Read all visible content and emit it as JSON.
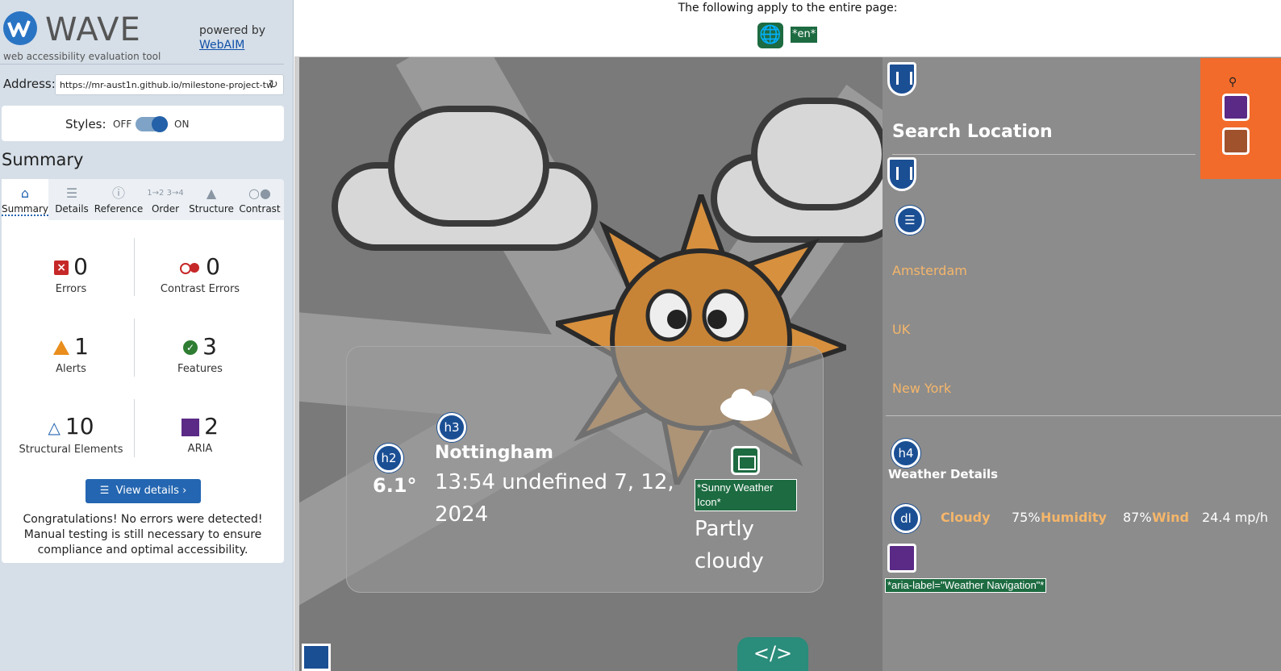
{
  "wave": {
    "logo_text": "WAVE",
    "tagline": "web accessibility evaluation tool",
    "powered_by": "powered by",
    "webaim_link": "WebAIM",
    "address_label": "Address:",
    "address_value": "https://mr-aust1n.github.io/milestone-project-tw",
    "styles_label": "Styles:",
    "styles_off": "OFF",
    "styles_on": "ON",
    "summary_title": "Summary",
    "tabs": [
      {
        "label": "Summary",
        "icon": "home-icon",
        "active": true
      },
      {
        "label": "Details",
        "icon": "list-icon",
        "active": false
      },
      {
        "label": "Reference",
        "icon": "info-icon",
        "active": false
      },
      {
        "label": "Order",
        "icon": "order-icon",
        "active": false
      },
      {
        "label": "Structure",
        "icon": "structure-icon",
        "active": false
      },
      {
        "label": "Contrast",
        "icon": "contrast-icon",
        "active": false
      }
    ],
    "stats": {
      "errors": {
        "value": "0",
        "label": "Errors"
      },
      "contrast_errors": {
        "value": "0",
        "label": "Contrast Errors"
      },
      "alerts": {
        "value": "1",
        "label": "Alerts"
      },
      "features": {
        "value": "3",
        "label": "Features"
      },
      "structural": {
        "value": "10",
        "label": "Structural Elements"
      },
      "aria": {
        "value": "2",
        "label": "ARIA"
      }
    },
    "view_details": "View details ›",
    "congrats": "Congratulations! No errors were detected! Manual testing is still necessary to ensure compliance and optimal accessibility."
  },
  "page_notice": {
    "text": "The following apply to the entire page:",
    "lang_tag": "*en*"
  },
  "weather_card": {
    "h2_badge": "h2",
    "h3_badge": "h3",
    "temperature": "6.1°",
    "city": "Nottingham",
    "datetime": "13:54 undefined 7, 12, 2024",
    "image_alt": "*Sunny Weather Icon*",
    "condition": "Partly cloudy"
  },
  "side_panel": {
    "title": "Search Location",
    "cities": [
      "Amsterdam",
      "UK",
      "New York"
    ],
    "h4_badge": "h4",
    "details_title": "Weather Details",
    "dl_badge": "dl",
    "details": [
      {
        "label": "Cloudy",
        "value": "75%"
      },
      {
        "label": "Humidity",
        "value": "87%"
      },
      {
        "label": "Wind",
        "value": "24.4 mp/h"
      }
    ],
    "aria_label_tag": "*aria-label=\"Weather Navigation\"*"
  },
  "bottom": {
    "code_tag": "</>"
  },
  "colors": {
    "wave_blue": "#2466b1",
    "feature_green": "#1d6b41",
    "aria_purple": "#5a2a86",
    "city_orange": "#f5b66a",
    "toolbar_orange": "#f26b2b"
  }
}
